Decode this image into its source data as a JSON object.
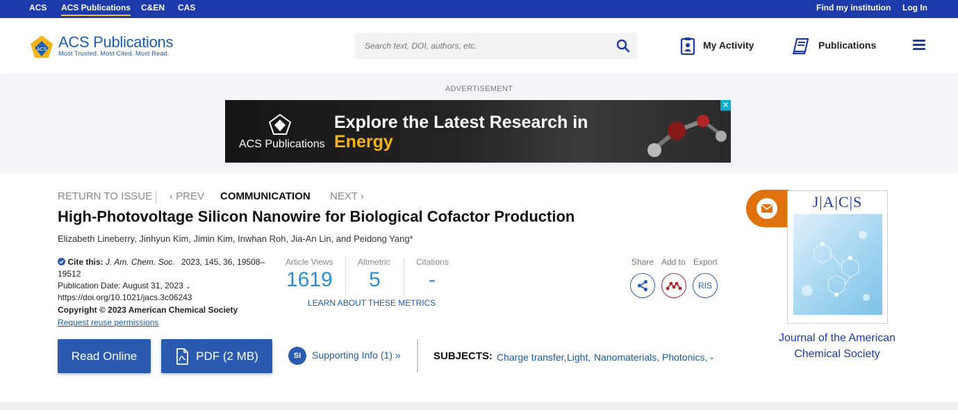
{
  "topbar": {
    "links": [
      "ACS",
      "ACS Publications",
      "C&EN",
      "CAS"
    ],
    "find_institution": "Find my institution",
    "login": "Log In"
  },
  "header": {
    "logo_title": "ACS Publications",
    "logo_tagline": "Most Trusted. Most Cited. Most Read.",
    "search_placeholder": "Search text, DOI, authors, etc.",
    "my_activity": "My Activity",
    "publications": "Publications"
  },
  "ad": {
    "label": "ADVERTISEMENT",
    "brand": "ACS Publications",
    "headline_1": "Explore the Latest Research in",
    "headline_2": "Energy",
    "close": "✕"
  },
  "breadcrumbs": {
    "return": "RETURN TO ISSUE",
    "prev": "‹ PREV",
    "type": "COMMUNICATION",
    "next": "NEXT ›"
  },
  "article": {
    "title": "High-Photovoltage Silicon Nanowire for Biological Cofactor Production",
    "authors": "Elizabeth Lineberry, Jinhyun Kim, Jimin Kim, Inwhan Roh, Jia-An Lin, and Peidong Yang*",
    "cite_label": "Cite this:",
    "cite_journal": "J. Am. Chem. Soc.",
    "cite_details_1": "2023, 145, 36, 19508–",
    "cite_details_2": "19512",
    "pub_date": "Publication Date: August 31, 2023",
    "doi": "https://doi.org/10.1021/jacs.3c06243",
    "copyright": "Copyright © 2023 American Chemical Society",
    "reuse": "Request reuse permissions"
  },
  "metrics": {
    "views_label": "Article Views",
    "views_value": "1619",
    "altmetric_label": "Altmetric",
    "altmetric_value": "5",
    "citations_label": "Citations",
    "citations_value": "-",
    "learn_more": "LEARN ABOUT THESE METRICS"
  },
  "actions": {
    "share": "Share",
    "add_to": "Add to",
    "export": "Export",
    "ris": "RIS"
  },
  "buttons": {
    "read_online": "Read Online",
    "pdf": "PDF (2 MB)",
    "si_badge": "SI",
    "supporting_info": "Supporting Info (1) »"
  },
  "subjects": {
    "label": "SUBJECTS:",
    "items": [
      "Charge transfer,",
      "Light,",
      "Nanomaterials,",
      "Photonics,"
    ]
  },
  "journal": {
    "cover_title": "J|A|C|S",
    "name": "Journal of the American Chemical Society"
  },
  "colors": {
    "topbar": "#1c3aa9",
    "button": "#2b5bb0",
    "metric": "#2a8fd0",
    "accent_orange": "#e0720e",
    "ad_yellow": "#f5b31a"
  }
}
